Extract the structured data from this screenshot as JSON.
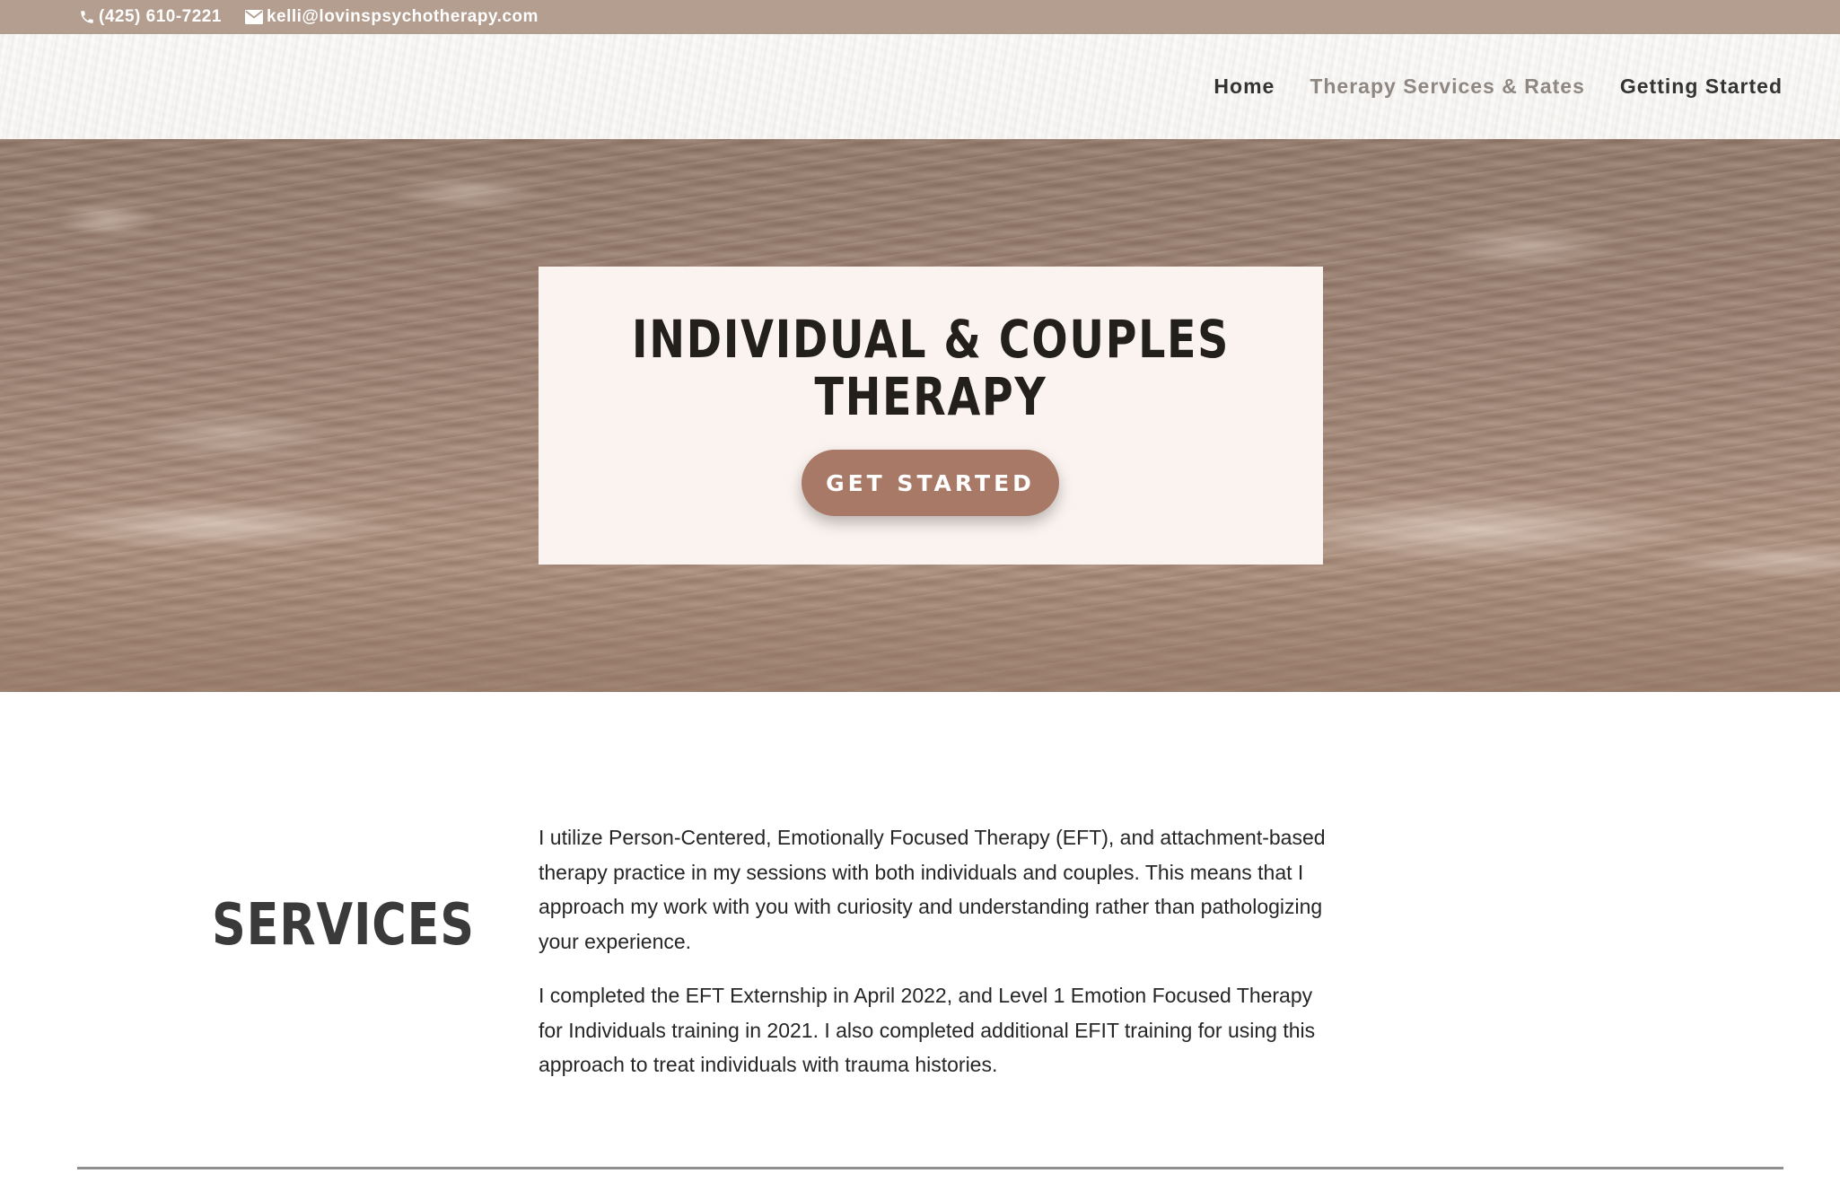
{
  "topbar": {
    "phone": "(425) 610-7221",
    "email": "kelli@lovinspsychotherapy.com",
    "phone_icon": "phone-icon",
    "email_icon": "envelope-icon"
  },
  "nav": {
    "items": [
      {
        "label": "Home",
        "active": false
      },
      {
        "label": "Therapy Services & Rates",
        "active": true
      },
      {
        "label": "Getting Started",
        "active": false
      }
    ]
  },
  "hero": {
    "title": "INDIVIDUAL & COUPLES THERAPY",
    "cta_label": "GET STARTED"
  },
  "services": {
    "heading": "SERVICES",
    "paragraphs": [
      "I utilize Person-Centered, Emotionally Focused Therapy (EFT), and attachment-based therapy practice in my sessions with both individuals and couples. This means that I approach my work with you with curiosity and understanding rather than pathologizing your experience.",
      "I completed the EFT Externship in April 2022, and Level 1 Emotion Focused Therapy for Individuals training in 2021. I also completed additional EFIT training for using this approach to treat individuals with trauma histories."
    ]
  },
  "colors": {
    "topbar_bg": "#b39e90",
    "card_bg": "#fbf3ef",
    "button_bg": "#a87966",
    "nav_active": "#8e8782"
  }
}
